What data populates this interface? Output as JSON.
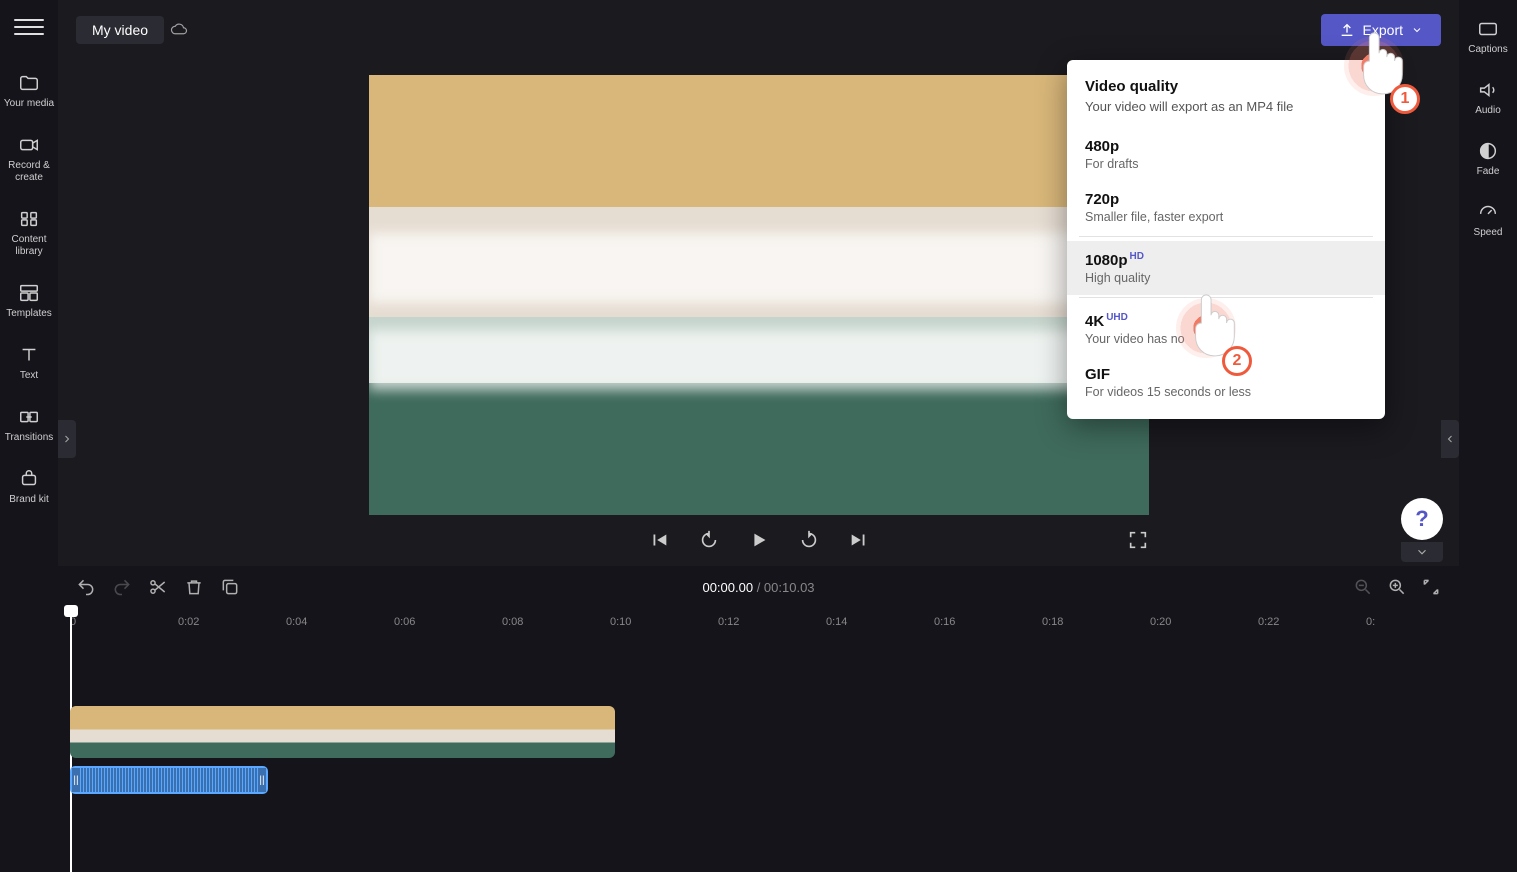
{
  "header": {
    "title": "My video",
    "exportLabel": "Export"
  },
  "leftSidebar": {
    "items": [
      {
        "id": "your-media",
        "label": "Your media"
      },
      {
        "id": "record-create",
        "label": "Record & create"
      },
      {
        "id": "content-library",
        "label": "Content library"
      },
      {
        "id": "templates",
        "label": "Templates"
      },
      {
        "id": "text",
        "label": "Text"
      },
      {
        "id": "transitions",
        "label": "Transitions"
      },
      {
        "id": "brand-kit",
        "label": "Brand kit"
      }
    ]
  },
  "rightSidebar": {
    "items": [
      {
        "id": "captions",
        "label": "Captions"
      },
      {
        "id": "audio",
        "label": "Audio"
      },
      {
        "id": "fade",
        "label": "Fade"
      },
      {
        "id": "speed",
        "label": "Speed"
      }
    ]
  },
  "exportPopup": {
    "heading": "Video quality",
    "subheading": "Your video will export as an MP4 file",
    "options": [
      {
        "title": "480p",
        "desc": "For drafts",
        "badge": ""
      },
      {
        "title": "720p",
        "desc": "Smaller file, faster export",
        "badge": ""
      },
      {
        "title": "1080p",
        "desc": "High quality",
        "badge": "HD",
        "selected": true
      },
      {
        "title": "4K",
        "desc": "Your video has no",
        "badge": "UHD"
      },
      {
        "title": "GIF",
        "desc": "For videos 15 seconds or less",
        "badge": ""
      }
    ]
  },
  "timeline": {
    "current": "00:00.00",
    "total": "00:10.03",
    "ruler": [
      "0",
      "0:02",
      "0:04",
      "0:06",
      "0:08",
      "0:10",
      "0:12",
      "0:14",
      "0:16",
      "0:18",
      "0:20",
      "0:22",
      "0:"
    ]
  },
  "annotations": {
    "a1": "1",
    "a2": "2"
  },
  "help": "?"
}
